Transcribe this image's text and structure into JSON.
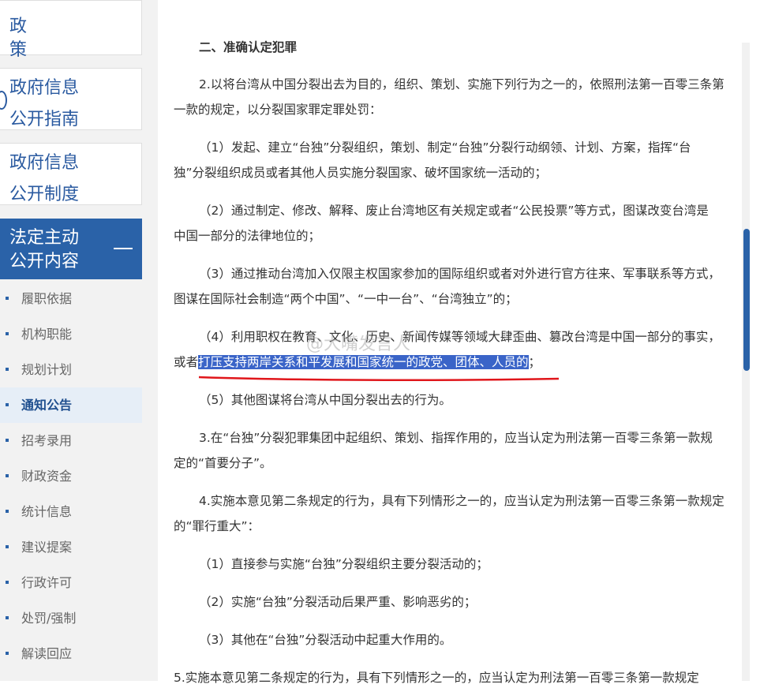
{
  "sidebar": {
    "policy": "政　策",
    "guide_line1": "政府信息",
    "guide_line2": "公开指南",
    "system_line1": "政府信息",
    "system_line2": "公开制度",
    "active_line1": "法定主动",
    "active_line2": "公开内容",
    "sub_items": [
      "履职依据",
      "机构职能",
      "规划计划",
      "通知公告",
      "招考录用",
      "财政资金",
      "统计信息",
      "建议提案",
      "行政许可",
      "处罚/强制",
      "解读回应"
    ]
  },
  "article": {
    "heading": "二、准确认定犯罪",
    "p2_l1": "2.以将台湾从中国分裂出去为目的，组织、策划、实施下列行为之一的，依照刑法第一百零三条第",
    "p2_l2": "一款的规定，以分裂国家罪定罪处罚：",
    "i1_l1": "（1）发起、建立“台独”分裂组织，策划、制定“台独”分裂行动纲领、计划、方案，指挥“台",
    "i1_l2": "独”分裂组织成员或者其他人员实施分裂国家、破坏国家统一活动的；",
    "i2_l1": "（2）通过制定、修改、解释、废止台湾地区有关规定或者“公民投票”等方式，图谋改变台湾是",
    "i2_l2": "中国一部分的法律地位的；",
    "i3_l1": "（3）通过推动台湾加入仅限主权国家参加的国际组织或者对外进行官方往来、军事联系等方式，",
    "i3_l2": "图谋在国际社会制造“两个中国”、“一中一台”、“台湾独立”的；",
    "i4_l1": "（4）利用职权在教育、文化、历史、新闻传媒等领域大肆歪曲、篡改台湾是中国一部分的事实，",
    "i4_l2_pre": "或者",
    "i4_l2_hl": "打压支持两岸关系和平发展和国家统一的政党、团体、人员的",
    "i4_l2_post": "；",
    "i5": "（5）其他图谋将台湾从中国分裂出去的行为。",
    "p3_l1": "3.在“台独”分裂犯罪集团中起组织、策划、指挥作用的，应当认定为刑法第一百零三条第一款规",
    "p3_l2": "定的“首要分子”。",
    "p4_l1": "4.实施本意见第二条规定的行为，具有下列情形之一的，应当认定为刑法第一百零三条第一款规定",
    "p4_l2": "的“罪行重大”：",
    "j1": "（1）直接参与实施“台独”分裂组织主要分裂活动的；",
    "j2": "（2）实施“台独”分裂活动后果严重、影响恶劣的；",
    "j3": "（3）其他在“台独”分裂活动中起重大作用的。",
    "p5_l1": "5.实施本意见第二条规定的行为，具有下列情形之一的，应当认定为刑法第一百零三条第一款规定"
  },
  "watermark": "@大嘴发言人",
  "colors": {
    "accent": "#2a62a8",
    "highlight": "#3a64c8",
    "underline": "#e0161b"
  }
}
